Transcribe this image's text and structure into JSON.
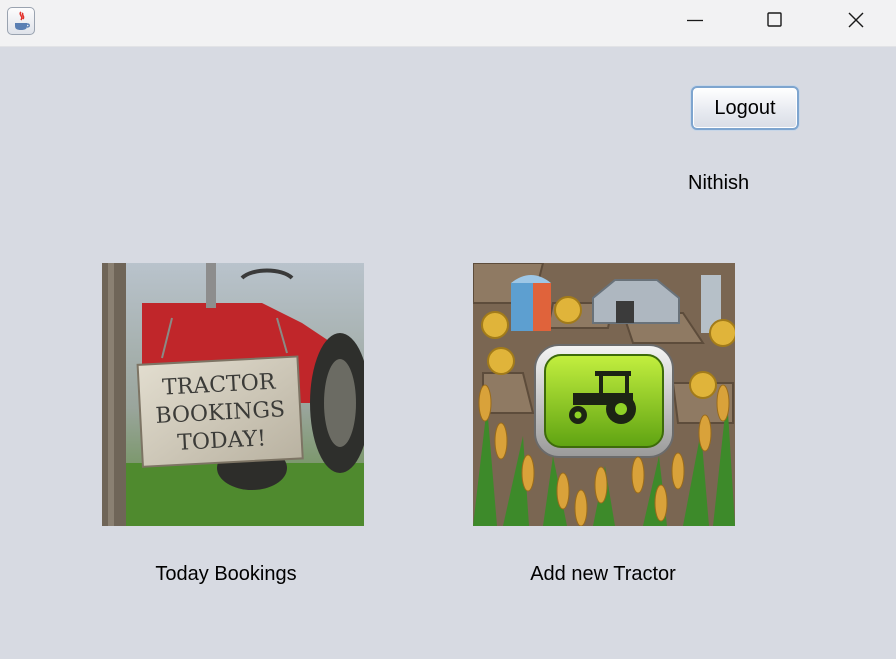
{
  "window": {
    "controls": [
      "minimize-icon",
      "maximize-icon",
      "close-icon"
    ]
  },
  "header": {
    "logout_label": "Logout",
    "username": "Nithish"
  },
  "tiles": [
    {
      "label": "Today Bookings",
      "sign_text": [
        "TRACTOR",
        "BOOKINGS",
        "TODAY!"
      ]
    },
    {
      "label": "Add new Tractor"
    }
  ],
  "colors": {
    "background": "#d7dae2",
    "titlebar": "#f2f2f3",
    "button_border": "#7ea5cf",
    "tractor_red": "#c0262a",
    "tractor_button_green": "#86c81a"
  }
}
